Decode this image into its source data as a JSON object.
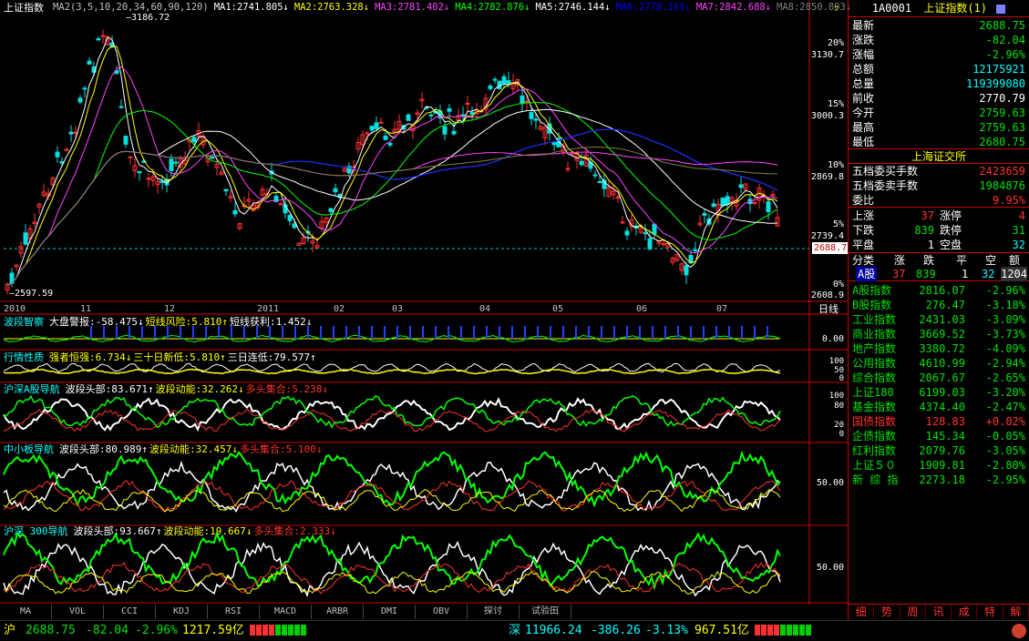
{
  "main_chart": {
    "title": "上证指数",
    "ma_legend": [
      {
        "label": "MA2(3,5,10,20,34,60,90,120)",
        "color": "#c0c0c0"
      },
      {
        "label": "MA1:2741.805↓",
        "color": "#ffffff"
      },
      {
        "label": "MA2:2763.328↓",
        "color": "#ffff00"
      },
      {
        "label": "MA3:2781.402↓",
        "color": "#ff40ff"
      },
      {
        "label": "MA4:2782.876↓",
        "color": "#00ff00"
      },
      {
        "label": "MA5:2746.144↓",
        "color": "#ffffff"
      },
      {
        "label": "MA6:2778.163↓",
        "color": "#0000ff"
      },
      {
        "label": "MA7:2842.688↓",
        "color": "#ff40ff"
      },
      {
        "label": "MA8:2850.893↓",
        "color": "#808080"
      }
    ],
    "high_marker": "3186.72",
    "low_marker": "2597.59",
    "y_axis_pct": [
      "20%",
      "15%",
      "10%",
      "5%",
      "0%"
    ],
    "y_axis_vals": [
      "3130.7",
      "3000.3",
      "2869.8",
      "2739.4",
      "2608.9"
    ],
    "current_price_tag": "2688.7",
    "x_axis": [
      "2010",
      "11",
      "12",
      "2011",
      "02",
      "03",
      "04",
      "05",
      "06",
      "07",
      "日线"
    ]
  },
  "indicators": [
    {
      "name": "波段智察",
      "items": [
        {
          "t": "大盘警报:-58.475↓",
          "c": "#ffffff"
        },
        {
          "t": "短线风险:5.810↑",
          "c": "#ffff00"
        },
        {
          "t": "短线获利:1.452↓",
          "c": "#ffffff"
        }
      ],
      "yvals": [
        "0.00"
      ]
    },
    {
      "name": "行情性质",
      "items": [
        {
          "t": "强者恒强:6.734↓",
          "c": "#ffff00"
        },
        {
          "t": "三十日新低:5.810↑",
          "c": "#ffff00"
        },
        {
          "t": "三日连低:79.577↑",
          "c": "#ffffff"
        }
      ],
      "yvals": [
        "100",
        "50",
        "0"
      ]
    },
    {
      "name": "沪深A股导航",
      "items": [
        {
          "t": "波段头部:83.671↑",
          "c": "#ffffff"
        },
        {
          "t": "波段动能:32.262↓",
          "c": "#ffff00"
        },
        {
          "t": "多头集合:5.238↓",
          "c": "#ff3030"
        }
      ],
      "yvals": [
        "100",
        "80",
        "20",
        "0"
      ]
    },
    {
      "name": "中小板导航",
      "items": [
        {
          "t": "波段头部:80.989↑",
          "c": "#ffffff"
        },
        {
          "t": "波段动能:32.457↓",
          "c": "#ffff00"
        },
        {
          "t": "多头集合:5.100↓",
          "c": "#ff3030"
        }
      ],
      "yvals": [
        "50.00"
      ]
    },
    {
      "name": "沪深 300导航",
      "items": [
        {
          "t": "波段头部:93.667↑",
          "c": "#ffffff"
        },
        {
          "t": "波段动能:19.667↓",
          "c": "#ffff00"
        },
        {
          "t": "多头集合:2.333↓",
          "c": "#ff3030"
        }
      ],
      "yvals": [
        "50.00"
      ]
    }
  ],
  "bottom_tabs": [
    "MA",
    "VOL",
    "CCI",
    "KDJ",
    "RSI",
    "MACD",
    "ARBR",
    "DMI",
    "OBV",
    "探讨",
    "试验田"
  ],
  "quote_panel": {
    "code": "1A0001",
    "name": "上证指数(1)",
    "rows": [
      {
        "k": "最新",
        "v": "2688.75",
        "c": "#00e000"
      },
      {
        "k": "涨跌",
        "v": "-82.04",
        "c": "#00e000"
      },
      {
        "k": "涨幅",
        "v": "-2.96%",
        "c": "#00e000"
      },
      {
        "k": "总额",
        "v": "12175921",
        "c": "#00ffff"
      },
      {
        "k": "总量",
        "v": "119399080",
        "c": "#00ffff"
      },
      {
        "k": "前收",
        "v": "2770.79",
        "c": "#ffffff"
      },
      {
        "k": "今开",
        "v": "2759.63",
        "c": "#00e000"
      },
      {
        "k": "最高",
        "v": "2759.63",
        "c": "#00e000"
      },
      {
        "k": "最低",
        "v": "2680.75",
        "c": "#00e000"
      }
    ],
    "exchange": "上海证交所",
    "rows2": [
      {
        "k": "五档委买手数",
        "v": "2423659",
        "c": "#ff3030"
      },
      {
        "k": "五档委卖手数",
        "v": "1984876",
        "c": "#00e000"
      },
      {
        "k": "委比",
        "v": "9.95%",
        "c": "#ff3030"
      }
    ],
    "breadth": [
      {
        "k1": "上涨",
        "v1": "37",
        "c1": "#ff3030",
        "k2": "涨停",
        "v2": "4",
        "c2": "#ff3030"
      },
      {
        "k1": "下跌",
        "v1": "839",
        "c1": "#00e000",
        "k2": "跌停",
        "v2": "31",
        "c2": "#00e000"
      },
      {
        "k1": "平盘",
        "v1": "1",
        "c1": "#ffffff",
        "k2": "空盘",
        "v2": "32",
        "c2": "#00ffff"
      }
    ],
    "class_header": [
      "分类",
      "涨",
      "跌",
      "平",
      "空",
      "额"
    ],
    "class_row": {
      "name": "A股",
      "up": "37",
      "down": "839",
      "flat": "1",
      "empty": "32",
      "amount": "1204"
    },
    "indices": [
      {
        "n": "A股指数",
        "p": "2816.07",
        "r": "-2.96%",
        "c": "#00e000"
      },
      {
        "n": "B股指数",
        "p": "276.47",
        "r": "-3.18%",
        "c": "#00e000"
      },
      {
        "n": "工业指数",
        "p": "2431.03",
        "r": "-3.09%",
        "c": "#00e000"
      },
      {
        "n": "商业指数",
        "p": "3669.52",
        "r": "-3.73%",
        "c": "#00e000"
      },
      {
        "n": "地产指数",
        "p": "3380.72",
        "r": "-4.09%",
        "c": "#00e000"
      },
      {
        "n": "公用指数",
        "p": "4610.99",
        "r": "-2.94%",
        "c": "#00e000"
      },
      {
        "n": "综合指数",
        "p": "2067.67",
        "r": "-2.65%",
        "c": "#00e000"
      },
      {
        "n": "上证180",
        "p": "6199.03",
        "r": "-3.20%",
        "c": "#00e000"
      },
      {
        "n": "基金指数",
        "p": "4374.40",
        "r": "-2.47%",
        "c": "#00e000"
      },
      {
        "n": "国债指数",
        "p": "128.83",
        "r": "+0.02%",
        "c": "#ff3030"
      },
      {
        "n": "企债指数",
        "p": "145.34",
        "r": "-0.05%",
        "c": "#00e000"
      },
      {
        "n": "红利指数",
        "p": "2079.76",
        "r": "-3.05%",
        "c": "#00e000"
      },
      {
        "n": "上证５０",
        "p": "1909.81",
        "r": "-2.80%",
        "c": "#00e000"
      },
      {
        "n": "新 综 指",
        "p": "2273.18",
        "r": "-2.95%",
        "c": "#00e000"
      }
    ],
    "tabs": [
      "细",
      "势",
      "周",
      "讯",
      "成",
      "特",
      "解"
    ]
  },
  "status_bar": {
    "sh_label": "沪",
    "sh_price": "2688.75",
    "sh_change": "-82.04",
    "sh_pct": "-2.96%",
    "sh_amount": "1217.59亿",
    "sz_label": "深",
    "sz_price": "11966.24",
    "sz_change": "-386.26",
    "sz_pct": "-3.13%",
    "sz_amount": "967.51亿"
  }
}
